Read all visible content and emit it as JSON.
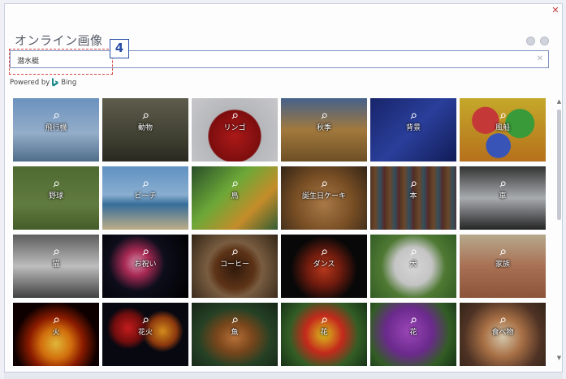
{
  "dialog": {
    "title": "オンライン画像",
    "close_icon": "close-icon",
    "title_icons": [
      "smiley-icon",
      "settings-icon"
    ]
  },
  "search": {
    "value": "潜水艇",
    "clear_glyph": "✕"
  },
  "callout": {
    "step_number": "4",
    "color": "#d84a44",
    "badge_color": "#2b4fa8"
  },
  "powered_by": {
    "prefix": "Powered by",
    "brand": "Bing"
  },
  "tiles": [
    {
      "label": "飛行機",
      "bg": "linear-gradient(180deg,#7aa6d8 0%,#a9c6e6 55%,#5b7d9c 100%)"
    },
    {
      "label": "動物",
      "bg": "linear-gradient(180deg,#6b6a58 0%,#4a4a3a 60%,#2f2f26 100%)"
    },
    {
      "label": "リンゴ",
      "bg": "radial-gradient(circle at 50% 60%,#c41d1d 0%,#8e1010 45%,#cfd0d4 47%,#e4e4e8 100%)"
    },
    {
      "label": "秋季",
      "bg": "linear-gradient(180deg,#4f6f9e 0%,#b98a46 50%,#7c5a2a 100%)"
    },
    {
      "label": "背景",
      "bg": "linear-gradient(135deg,#1c2a7a 0%,#3048b0 50%,#142064 100%)"
    },
    {
      "label": "風船",
      "bg": "radial-gradient(circle at 30% 35%,#e04040 0%,#e04040 18%,transparent 19%),radial-gradient(circle at 70% 40%,#40b040 0%,#40b040 20%,transparent 21%),radial-gradient(circle at 45% 75%,#4060d0 0%,#4060d0 18%,transparent 19%),linear-gradient(#e0c030,#d08020)"
    },
    {
      "label": "野球",
      "bg": "linear-gradient(180deg,#5a7a3a 0%,#6e8c48 60%,#4e6a30 100%)"
    },
    {
      "label": "ビーチ",
      "bg": "linear-gradient(180deg,#6fa6de 0%,#9cc6ec 45%,#3f7db0 60%,#d8c69a 100%)"
    },
    {
      "label": "鳥",
      "bg": "linear-gradient(135deg,#2f5a2f 0%,#7cc040 40%,#e0a030 70%,#3a6a3a 100%)"
    },
    {
      "label": "誕生日ケーキ",
      "bg": "radial-gradient(circle at 50% 60%,#c08a50 0%,#8a5a2a 50%,#3a2a1a 100%)"
    },
    {
      "label": "本",
      "bg": "repeating-linear-gradient(90deg,#5a3a2a 0px,#7a5030 6px,#3a5a6a 12px,#6a2a2a 18px)"
    },
    {
      "label": "車",
      "bg": "linear-gradient(180deg,#3a3a3a 0%,#c0c4c8 50%,#2a2a2a 100%)"
    },
    {
      "label": "猫",
      "bg": "linear-gradient(180deg,#6a6a6a 0%,#d8d8d8 50%,#4a4a4a 100%)"
    },
    {
      "label": "お祝い",
      "bg": "radial-gradient(circle at 40% 45%,#f0a0c0 0%,#c03060 20%,#101020 45%,#000 100%)"
    },
    {
      "label": "コーヒー",
      "bg": "radial-gradient(circle at 50% 55%,#3a1f10 0%,#6a3a1a 35%,#8a6a4a 50%,#3a2a1a 100%)"
    },
    {
      "label": "ダンス",
      "bg": "radial-gradient(circle at 50% 55%,#d04020 0%,#802010 30%,#0a0a0a 60%)"
    },
    {
      "label": "犬",
      "bg": "radial-gradient(circle at 50% 50%,#f4f4f4 0%,#e0e0e0 35%,#5a8a3a 60%,#3a6a2a 100%)"
    },
    {
      "label": "家族",
      "bg": "linear-gradient(180deg,#d0c0a0 0%,#c08060 50%,#a06040 100%)"
    },
    {
      "label": "火",
      "bg": "radial-gradient(circle at 50% 65%,#ffd040 0%,#f08010 25%,#a02000 45%,#100000 70%)"
    },
    {
      "label": "花火",
      "bg": "radial-gradient(circle at 30% 40%,#e02020 0%,#801010 20%,transparent 30%),radial-gradient(circle at 70% 45%,#f0a020 0%,#a04010 20%,transparent 30%),#0a0a14"
    },
    {
      "label": "魚",
      "bg": "radial-gradient(ellipse at 50% 55%,#d08040 0%,#8a5020 30%,#2a4a2a 60%,#1a2a1a 100%)"
    },
    {
      "label": "花",
      "bg": "radial-gradient(circle at 50% 50%,#f0d020 0%,#f0a020 12%,#e03020 35%,#3a6a2a 65%,#1a3a1a 100%)"
    },
    {
      "label": "花",
      "bg": "radial-gradient(circle at 45% 45%,#b050d0 0%,#7a30a0 40%,#3a6a2a 70%,#1a3a1a 100%)"
    },
    {
      "label": "食べ物",
      "bg": "radial-gradient(circle at 50% 55%,#f0e0c0 0%,#c08050 35%,#5a3a2a 70%,#3a2a1a 100%)"
    }
  ]
}
